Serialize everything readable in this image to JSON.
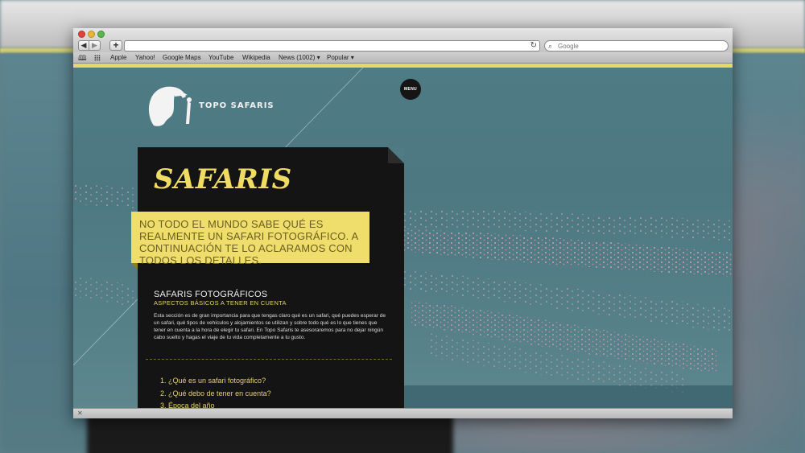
{
  "browser": {
    "search_placeholder": "Google",
    "nav": {
      "back": "◀",
      "forward": "▶",
      "add": "+",
      "reload": "↻"
    },
    "bookmarks": [
      "Apple",
      "Yahoo!",
      "Google Maps",
      "YouTube",
      "Wikipedia",
      "News (1002) ▾",
      "Popular ▾"
    ]
  },
  "site": {
    "brand": "TOPO SAFARIS",
    "menu_label": "MENU",
    "title": "SAFARIS",
    "banner": "NO TODO EL MUNDO SABE QUÉ ES REALMENTE UN SAFARI FOTOGRÁFICO. A CONTINUACIÓN TE LO ACLARAMOS CON TODOS LOS DETALLES.",
    "section": {
      "heading": "SAFARIS FOTOGRÁFICOS",
      "caption": "ASPECTOS BÁSICOS A TENER EN CUENTA",
      "body": "Esta sección es de gran importancia para que tengas claro qué es un safari, qué puedes esperar de un safari, qué tipos de vehículos y alojamientos se utilizan y sobre todo qué es lo que tienes que tener en cuenta a la hora de elegir tu safari. En Topo Safaris te asesoraremos para no dejar ningún cabo suelto y hagas el viaje de tu vida completamente a tu gusto."
    },
    "faq": [
      "1. ¿Qué es un safari fotográfico?",
      "2. ¿Qué debo de tener en cuenta?",
      "3. Época del año"
    ]
  },
  "colors": {
    "accent_yellow": "#efdd6c",
    "title_yellow": "#f0dc62",
    "panel": "#141414",
    "lake_teal": "#4f7b85",
    "flamingo_pink": "#e6a4b4"
  }
}
